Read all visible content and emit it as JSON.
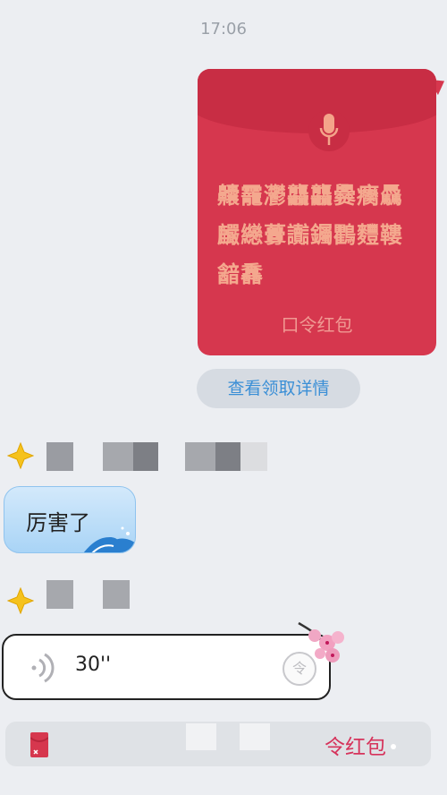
{
  "timestamp": "17:06",
  "red_packet": {
    "password_text": "齉靇灪龘龘爨癵驫麣纞虋讟钃鸜麷鞻韽馫",
    "label": "口令红包",
    "icon": "microphone-icon",
    "color": "#d6374e"
  },
  "details_button": "查看领取详情",
  "received_bubble": {
    "text": "厉害了"
  },
  "voice_message": {
    "duration": "30''",
    "badge": "令"
  },
  "input_bar": {
    "text": "令红包"
  }
}
